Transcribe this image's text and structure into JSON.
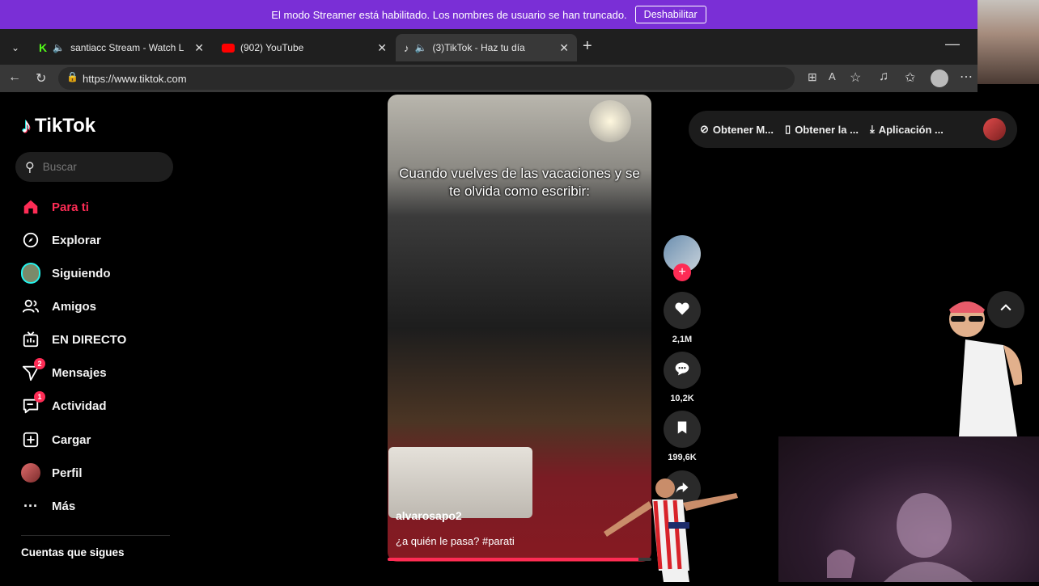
{
  "banner": {
    "message": "El modo Streamer está habilitado. Los nombres de usuario se han truncado.",
    "button": "Deshabilitar"
  },
  "browser": {
    "tabs": [
      {
        "title": "santiacc Stream - Watch Live o",
        "icon": "kick-icon",
        "muted": true
      },
      {
        "title": "(902) YouTube",
        "icon": "youtube-icon",
        "muted": false
      },
      {
        "title": "(3)TikTok - Haz tu día",
        "icon": "tiktok-icon",
        "muted": true,
        "active": true
      }
    ],
    "url": "https://www.tiktok.com"
  },
  "tiktok": {
    "logo": "TikTok",
    "search_placeholder": "Buscar",
    "nav": [
      {
        "label": "Para ti",
        "icon": "home-icon"
      },
      {
        "label": "Explorar",
        "icon": "compass-icon"
      },
      {
        "label": "Siguiendo",
        "icon": "following-avatar-icon"
      },
      {
        "label": "Amigos",
        "icon": "friends-icon"
      },
      {
        "label": "EN DIRECTO",
        "icon": "live-icon"
      },
      {
        "label": "Mensajes",
        "icon": "send-icon",
        "badge": "2"
      },
      {
        "label": "Actividad",
        "icon": "activity-icon",
        "badge": "1"
      },
      {
        "label": "Cargar",
        "icon": "upload-icon"
      },
      {
        "label": "Perfil",
        "icon": "profile-avatar-icon"
      },
      {
        "label": "Más",
        "icon": "more-icon"
      }
    ],
    "following_section_title": "Cuentas que sigues",
    "top_actions": [
      {
        "label": "Obtener M...",
        "icon": "coin-icon"
      },
      {
        "label": "Obtener la ...",
        "icon": "phone-icon"
      },
      {
        "label": "Aplicación ...",
        "icon": "download-icon"
      }
    ],
    "video": {
      "caption": "Cuando vuelves de las vacaciones y se te olvida como escribir:",
      "author": "alvarosapo2",
      "description": "¿a quién le pasa? #parati",
      "progress": 0.95
    },
    "actions": {
      "likes": "2,1M",
      "comments": "10,2K",
      "saves": "199,6K"
    }
  },
  "colors": {
    "accent": "#fe2c55",
    "banner": "#7a2fd6"
  }
}
